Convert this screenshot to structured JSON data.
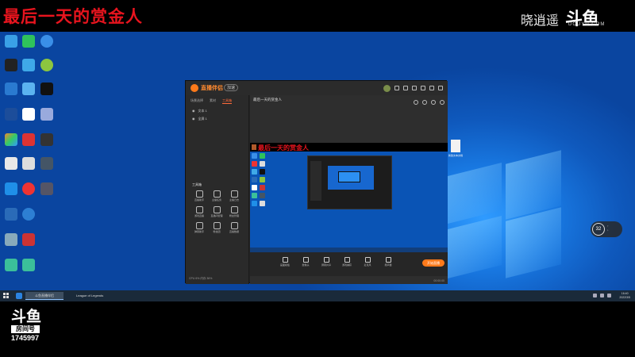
{
  "overlay": {
    "stream_title": "最后一天的赏金人",
    "streamer_name": "晓逍遥",
    "logo_mark": "斗鱼",
    "logo_domain": "DOUYU.COM",
    "room_label": "房间号",
    "room_number": "1745997"
  },
  "app": {
    "name": "直播伴侣",
    "tag": "加速",
    "room_title": "最后一天的赏金人",
    "left_tabs": [
      "场景选择",
      "素材",
      "工具箱"
    ],
    "scenes": [
      "文本 1",
      "全屏 1"
    ],
    "tools_title": "工具箱",
    "tools": [
      "直播助手",
      "主播任务",
      "主播日志",
      "游戏直播",
      "直播间管理",
      "粉丝管理",
      "弹幕助手",
      "粉丝团",
      "直播数据"
    ],
    "left_status": "CPU 6% 内存 36%",
    "controls": [
      "画面模板",
      "摄像头",
      "屏幕共享",
      "游戏捕获",
      "麦克风",
      "扬声器"
    ],
    "go_live": "开始直播",
    "main_status": "00:00:00"
  },
  "desktop": {
    "file_label": "新建文本文档",
    "float_value": "32"
  },
  "taskbar": {
    "items": [
      "斗鱼直播伴侣",
      "League of Legends"
    ],
    "time": "16:40",
    "date": "2022/3/5"
  }
}
